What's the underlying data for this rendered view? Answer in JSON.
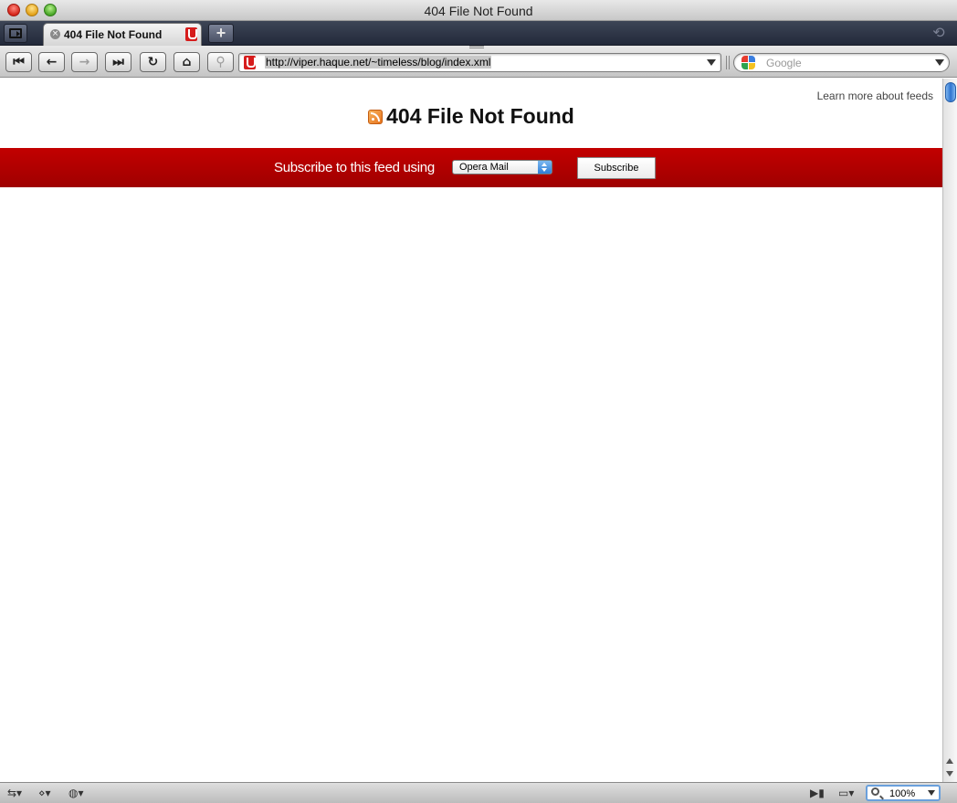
{
  "window": {
    "title": "404 File Not Found"
  },
  "tabs": [
    {
      "title": "404 File Not Found",
      "close_glyph": "×"
    }
  ],
  "newtab": {
    "glyph": "+"
  },
  "closedtabs": {
    "glyph": "⟲"
  },
  "toolbar": {
    "rewind_glyph": "⏮",
    "back_glyph": "←",
    "forward_glyph": "→",
    "fastforward_glyph": "⏭",
    "reload_glyph": "↻",
    "home_glyph": "⌂",
    "wand_glyph": "⚲",
    "address": "http://viper.haque.net/~timeless/blog/index.xml",
    "search_placeholder": "Google"
  },
  "page": {
    "learn_more": "Learn more about feeds",
    "heading": "404 File Not Found",
    "subscribe_label": "Subscribe to this feed using",
    "reader_selected": "Opera Mail",
    "subscribe_button": "Subscribe"
  },
  "statusbar": {
    "sync_glyph": "⇆▾",
    "unite_glyph": "⋄▾",
    "turbo_glyph": "◍▾",
    "camera_glyph": "▶▮",
    "view_glyph": "▭▾",
    "zoom": "100%"
  },
  "colors": {
    "feed_bar": "#b00000",
    "select_arrow": "#2f7ed8",
    "opera_red": "#d61c1c"
  }
}
